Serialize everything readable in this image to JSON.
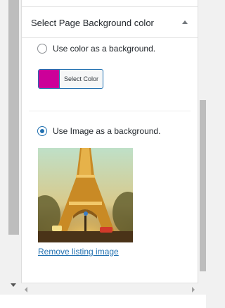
{
  "section": {
    "title": "Select Page Background color"
  },
  "options": {
    "color_bg_label": "Use color as a background.",
    "color_button_label": "Select Color",
    "image_bg_label": "Use Image as a background."
  },
  "colors": {
    "selected_swatch": "#cc0099",
    "accent": "#2271b1"
  },
  "image": {
    "remove_link": "Remove listing image",
    "subject": "eiffel-tower-photo"
  },
  "state": {
    "selected_option": "image"
  }
}
